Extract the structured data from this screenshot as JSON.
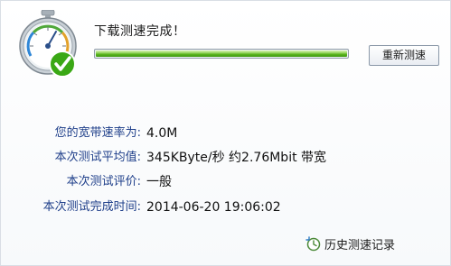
{
  "status": {
    "title": "下载测速完成！",
    "progress_fraction": 1.0,
    "retest_label": "重新测速"
  },
  "results": [
    {
      "label": "您的宽带速率为:",
      "value": "4.0M"
    },
    {
      "label": "本次测试平均值:",
      "value": "345KByte/秒 约2.76Mbit 带宽"
    },
    {
      "label": "本次测试评价:",
      "value": "一般"
    },
    {
      "label": "本次测试完成时间:",
      "value": "2014-06-20 19:06:02"
    }
  ],
  "history": {
    "label": "历史测速记录",
    "icon": "clock-arrow-icon"
  },
  "icons": {
    "gauge": "speed-gauge-icon",
    "check": "check-badge-icon"
  },
  "colors": {
    "label_text": "#1f3f8a",
    "progress_green": "#5ab51e",
    "check_green": "#3aa815"
  }
}
